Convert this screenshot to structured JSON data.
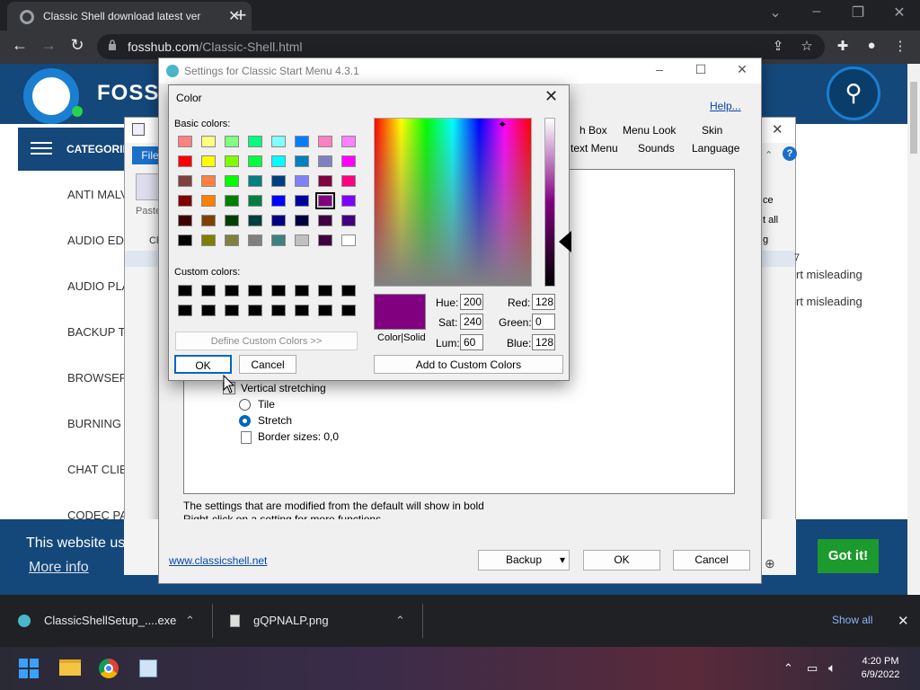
{
  "browser": {
    "tab_title": "Classic Shell download latest ver",
    "url_domain": "fosshub.com",
    "url_path": "/Classic-Shell.html"
  },
  "site": {
    "logo_text": "FOSS",
    "categories_label": "CATEGORIES",
    "categories": [
      "ANTI MALV",
      "AUDIO EDI",
      "AUDIO PLA",
      "BACKUP TO",
      "BROWSERS",
      "BURNING T",
      "CHAT CLIE",
      "CODEC PAC"
    ],
    "right_text_1": "rt misleading",
    "right_text_2": "rt misleading",
    "cookie_text": "This website us",
    "cookie_more": "More info",
    "got_it": "Got it!"
  },
  "notepad": {
    "file_menu": "File",
    "paste": "Paste",
    "cl": "Cl",
    "right_1": "ce",
    "right_2": "t all",
    "right_3": "g",
    "ruler_right": "7"
  },
  "settings": {
    "title": "Settings for Classic Start Menu 4.3.1",
    "help": "Help...",
    "tabs_row1": [
      "h Box",
      "Menu Look",
      "Skin"
    ],
    "tabs_row2": [
      "text Menu",
      "Sounds",
      "Language"
    ],
    "items": {
      "vertical": "Vertical stretching",
      "tile": "Tile",
      "stretch": "Stretch",
      "border": "Border sizes: 0,0"
    },
    "info1": "The settings that are modified from the default will show in bold",
    "info2": "Right-click on a setting for more functions",
    "link": "www.classicshell.net",
    "backup": "Backup",
    "ok": "OK",
    "cancel": "Cancel"
  },
  "color_dialog": {
    "title": "Color",
    "basic_label": "Basic colors:",
    "custom_label": "Custom colors:",
    "define_btn": "Define Custom Colors >>",
    "ok": "OK",
    "cancel": "Cancel",
    "add_btn": "Add to Custom Colors",
    "preview_label": "Color|Solid",
    "hue_label": "Hue:",
    "hue": "200",
    "sat_label": "Sat:",
    "sat": "240",
    "lum_label": "Lum:",
    "lum": "60",
    "red_label": "Red:",
    "red": "128",
    "green_label": "Green:",
    "green": "0",
    "blue_label": "Blue:",
    "blue": "128",
    "basic_colors": [
      "#ff8080",
      "#ffff80",
      "#80ff80",
      "#00ff80",
      "#80ffff",
      "#0080ff",
      "#ff80c0",
      "#ff80ff",
      "#ff0000",
      "#ffff00",
      "#80ff00",
      "#00ff40",
      "#00ffff",
      "#0080c0",
      "#8080c0",
      "#ff00ff",
      "#804040",
      "#ff8040",
      "#00ff00",
      "#008080",
      "#004080",
      "#8080ff",
      "#800040",
      "#ff0080",
      "#800000",
      "#ff8000",
      "#008000",
      "#008040",
      "#0000ff",
      "#0000a0",
      "#800080",
      "#8000ff",
      "#400000",
      "#804000",
      "#004000",
      "#004040",
      "#000080",
      "#000040",
      "#400040",
      "#400080",
      "#000000",
      "#808000",
      "#808040",
      "#808080",
      "#408080",
      "#c0c0c0",
      "#400040",
      "#ffffff"
    ],
    "selected_index": 30
  },
  "downloads": {
    "item1": "ClassicShellSetup_....exe",
    "item2": "gQPNALP.png",
    "show_all": "Show all"
  },
  "taskbar": {
    "time": "4:20 PM",
    "date": "6/9/2022"
  }
}
